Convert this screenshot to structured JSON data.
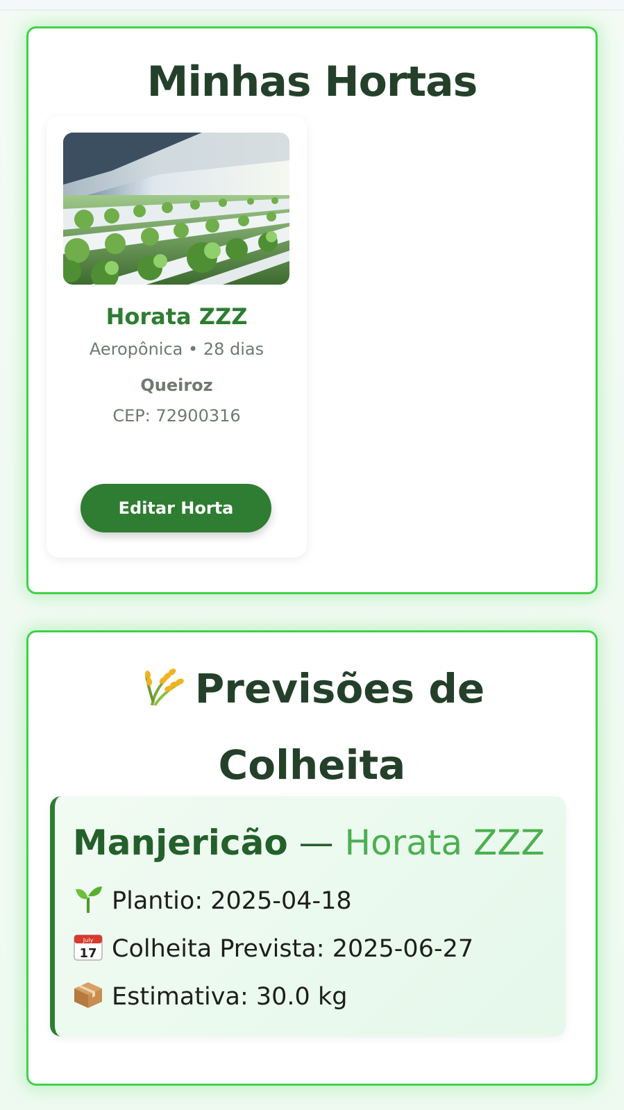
{
  "hortas_section": {
    "title": "Minhas Hortas",
    "cards": [
      {
        "image_icon": "hydroponic-greenhouse-photo",
        "name": "Horata ZZZ",
        "system": "Aeropônica",
        "separator": "•",
        "duration": "28 dias",
        "owner": "Queiroz",
        "cep_label": "CEP:",
        "cep": "72900316",
        "edit_label": "Editar Horta"
      }
    ]
  },
  "previsoes_section": {
    "icon": "wheat-icon",
    "title": "Previsões de Colheita",
    "items": [
      {
        "crop": "Manjericão",
        "separator": "—",
        "horta": "Horata ZZZ",
        "plantio_icon": "seedling-icon",
        "plantio_label": "Plantio:",
        "plantio_value": "2025-04-18",
        "colheita_icon": "calendar-icon",
        "colheita_label": "Colheita Prevista:",
        "colheita_value": "2025-06-27",
        "estimativa_icon": "package-icon",
        "estimativa_label": "Estimativa:",
        "estimativa_value": "30.0 kg"
      }
    ]
  },
  "colors": {
    "accent": "#2e7d32",
    "panel_border": "#3fd14a",
    "horta_link": "#4caf50",
    "title": "#24402a"
  }
}
